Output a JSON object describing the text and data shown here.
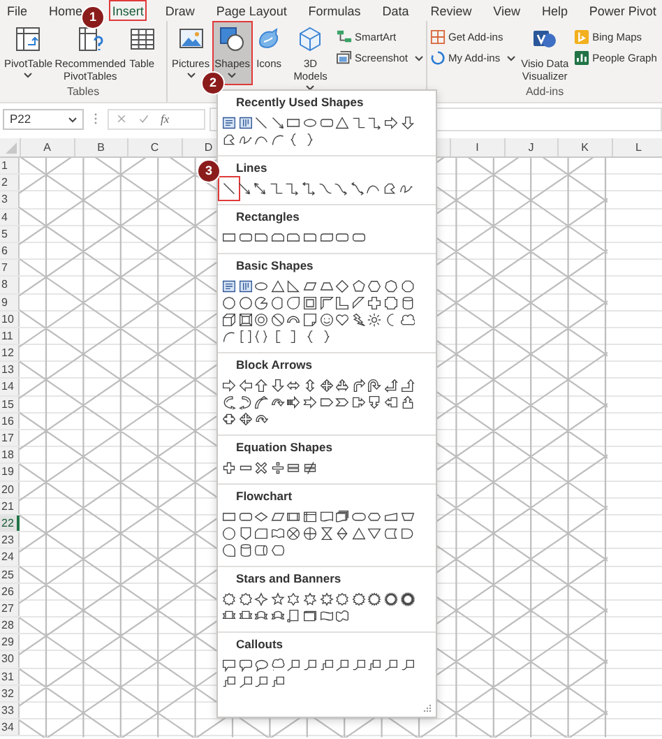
{
  "tabs": [
    {
      "label": "File",
      "selected": false,
      "marked": false
    },
    {
      "label": "Home",
      "selected": false,
      "marked": false
    },
    {
      "label": "Insert",
      "selected": true,
      "marked": true
    },
    {
      "label": "Draw",
      "selected": false,
      "marked": false
    },
    {
      "label": "Page Layout",
      "selected": false,
      "marked": false
    },
    {
      "label": "Formulas",
      "selected": false,
      "marked": false
    },
    {
      "label": "Data",
      "selected": false,
      "marked": false
    },
    {
      "label": "Review",
      "selected": false,
      "marked": false
    },
    {
      "label": "View",
      "selected": false,
      "marked": false
    },
    {
      "label": "Help",
      "selected": false,
      "marked": false
    },
    {
      "label": "Power Pivot",
      "selected": false,
      "marked": false
    }
  ],
  "ribbon": {
    "pivot_table": "PivotTable",
    "recommended_pivot_tables": "Recommended PivotTables",
    "table": "Table",
    "tables_label": "Tables",
    "pictures": "Pictures",
    "shapes": {
      "label": "Shapes",
      "pressed": true,
      "marked": true
    },
    "icons": "Icons",
    "models": "3D Models",
    "smartart": "SmartArt",
    "screenshot": "Screenshot",
    "get_addins": "Get Add-ins",
    "my_addins": "My Add-ins",
    "visio": "Visio Data Visualizer",
    "bing_maps": "Bing Maps",
    "people_graph": "People Graph",
    "addins_label": "Add-ins"
  },
  "formula_bar": {
    "name_box": "P22",
    "function": "fx"
  },
  "columns_left": [
    "A",
    "B",
    "C",
    "D"
  ],
  "columns_right": [
    "I",
    "J",
    "K",
    "L"
  ],
  "rows": [
    {
      "label": "1",
      "selected": false
    },
    {
      "label": "2",
      "selected": false
    },
    {
      "label": "3",
      "selected": false
    },
    {
      "label": "4",
      "selected": false
    },
    {
      "label": "5",
      "selected": false
    },
    {
      "label": "6",
      "selected": false
    },
    {
      "label": "7",
      "selected": false
    },
    {
      "label": "8",
      "selected": false
    },
    {
      "label": "9",
      "selected": false
    },
    {
      "label": "10",
      "selected": false
    },
    {
      "label": "11",
      "selected": false
    },
    {
      "label": "12",
      "selected": false
    },
    {
      "label": "13",
      "selected": false
    },
    {
      "label": "14",
      "selected": false
    },
    {
      "label": "15",
      "selected": false
    },
    {
      "label": "16",
      "selected": false
    },
    {
      "label": "17",
      "selected": false
    },
    {
      "label": "18",
      "selected": false
    },
    {
      "label": "19",
      "selected": false
    },
    {
      "label": "20",
      "selected": false
    },
    {
      "label": "21",
      "selected": false
    },
    {
      "label": "22",
      "selected": true
    },
    {
      "label": "23",
      "selected": false
    },
    {
      "label": "24",
      "selected": false
    },
    {
      "label": "25",
      "selected": false
    },
    {
      "label": "26",
      "selected": false
    },
    {
      "label": "27",
      "selected": false
    },
    {
      "label": "28",
      "selected": false
    },
    {
      "label": "29",
      "selected": false
    },
    {
      "label": "30",
      "selected": false
    },
    {
      "label": "31",
      "selected": false
    },
    {
      "label": "32",
      "selected": false
    },
    {
      "label": "33",
      "selected": false
    },
    {
      "label": "34",
      "selected": false
    }
  ],
  "shapes_menu": {
    "sections": [
      {
        "title": "Recently Used Shapes",
        "rows": [
          [
            {
              "kind": "text-box"
            },
            {
              "kind": "vertical-text-box"
            },
            {
              "kind": "line"
            },
            {
              "kind": "line-arrow"
            },
            {
              "kind": "rectangle"
            },
            {
              "kind": "oval"
            },
            {
              "kind": "rounded-rectangle"
            },
            {
              "kind": "triangle"
            },
            {
              "kind": "elbow-connector"
            },
            {
              "kind": "elbow-arrow"
            },
            {
              "kind": "right-arrow"
            },
            {
              "kind": "down-arrow"
            }
          ],
          [
            {
              "kind": "freeform"
            },
            {
              "kind": "scribble"
            },
            {
              "kind": "curve"
            },
            {
              "kind": "arc"
            },
            {
              "kind": "left-brace"
            },
            {
              "kind": "right-brace"
            }
          ]
        ]
      },
      {
        "title": "Lines",
        "rows": [
          [
            {
              "kind": "line",
              "highlighted": true
            },
            {
              "kind": "line-arrow",
              "highlighted": false
            },
            {
              "kind": "double-arrow-line",
              "highlighted": false
            },
            {
              "kind": "elbow-connector",
              "highlighted": false
            },
            {
              "kind": "elbow-arrow",
              "highlighted": false
            },
            {
              "kind": "elbow-double-arrow",
              "highlighted": false
            },
            {
              "kind": "curved-connector",
              "highlighted": false
            },
            {
              "kind": "curved-arrow",
              "highlighted": false
            },
            {
              "kind": "curved-double-arrow",
              "highlighted": false
            },
            {
              "kind": "curve",
              "highlighted": false
            },
            {
              "kind": "freeform",
              "highlighted": false
            },
            {
              "kind": "scribble",
              "highlighted": false
            }
          ]
        ]
      },
      {
        "title": "Rectangles",
        "rows": [
          [
            {
              "kind": "rectangle"
            },
            {
              "kind": "rounded-rectangle"
            },
            {
              "kind": "snipped-rectangle"
            },
            {
              "kind": "snipped-corners"
            },
            {
              "kind": "snip-round-rectangle"
            },
            {
              "kind": "round-corner-rectangle"
            },
            {
              "kind": "round-corners"
            },
            {
              "kind": "rounded-rectangle"
            },
            {
              "kind": "rounded-rectangle"
            }
          ]
        ]
      },
      {
        "title": "Basic Shapes",
        "rows": [
          [
            {
              "kind": "text-box"
            },
            {
              "kind": "vertical-text-box"
            },
            {
              "kind": "oval"
            },
            {
              "kind": "triangle"
            },
            {
              "kind": "right-triangle"
            },
            {
              "kind": "parallelogram"
            },
            {
              "kind": "trapezoid"
            },
            {
              "kind": "diamond"
            },
            {
              "kind": "pentagon"
            },
            {
              "kind": "hexagon"
            },
            {
              "kind": "heptagon"
            },
            {
              "kind": "octagon"
            }
          ],
          [
            {
              "kind": "decagon"
            },
            {
              "kind": "dodecagon"
            },
            {
              "kind": "pie"
            },
            {
              "kind": "chord"
            },
            {
              "kind": "teardrop"
            },
            {
              "kind": "frame"
            },
            {
              "kind": "half-frame"
            },
            {
              "kind": "l-shape"
            },
            {
              "kind": "diagonal-stripe"
            },
            {
              "kind": "cross"
            },
            {
              "kind": "plaque"
            },
            {
              "kind": "cylinder"
            }
          ],
          [
            {
              "kind": "cube"
            },
            {
              "kind": "bevel"
            },
            {
              "kind": "donut"
            },
            {
              "kind": "no-symbol"
            },
            {
              "kind": "block-arc"
            },
            {
              "kind": "folded-corner"
            },
            {
              "kind": "smiley"
            },
            {
              "kind": "heart"
            },
            {
              "kind": "lightning"
            },
            {
              "kind": "sun"
            },
            {
              "kind": "moon"
            },
            {
              "kind": "cloud"
            }
          ],
          [
            {
              "kind": "arc"
            },
            {
              "kind": "double-bracket"
            },
            {
              "kind": "double-brace"
            },
            {
              "kind": "left-bracket"
            },
            {
              "kind": "right-bracket"
            },
            {
              "kind": "left-brace"
            },
            {
              "kind": "right-brace"
            }
          ]
        ]
      },
      {
        "title": "Block Arrows",
        "rows": [
          [
            {
              "kind": "right-arrow"
            },
            {
              "kind": "left-arrow"
            },
            {
              "kind": "up-arrow"
            },
            {
              "kind": "down-arrow"
            },
            {
              "kind": "left-right-arrow"
            },
            {
              "kind": "up-down-arrow"
            },
            {
              "kind": "quad-arrow"
            },
            {
              "kind": "left-right-up-arrow"
            },
            {
              "kind": "bent-arrow"
            },
            {
              "kind": "u-turn-arrow"
            },
            {
              "kind": "left-up-arrow"
            },
            {
              "kind": "bent-up-arrow"
            }
          ],
          [
            {
              "kind": "curved-right-arrow"
            },
            {
              "kind": "curved-left-arrow"
            },
            {
              "kind": "curved-up-arrow"
            },
            {
              "kind": "curved-down-arrow"
            },
            {
              "kind": "striped-right-arrow"
            },
            {
              "kind": "notched-right-arrow"
            },
            {
              "kind": "pentagon-arrow"
            },
            {
              "kind": "chevron"
            },
            {
              "kind": "right-arrow-callout"
            },
            {
              "kind": "down-arrow-callout"
            },
            {
              "kind": "left-arrow-callout"
            },
            {
              "kind": "up-arrow-callout"
            }
          ],
          [
            {
              "kind": "left-right-arrow-callout"
            },
            {
              "kind": "quad-arrow"
            },
            {
              "kind": "circular-arrow"
            }
          ]
        ]
      },
      {
        "title": "Equation Shapes",
        "rows": [
          [
            {
              "kind": "plus-sign"
            },
            {
              "kind": "minus-sign"
            },
            {
              "kind": "multiply-sign"
            },
            {
              "kind": "division-sign"
            },
            {
              "kind": "equal-sign"
            },
            {
              "kind": "not-equal-sign"
            }
          ]
        ]
      },
      {
        "title": "Flowchart",
        "rows": [
          [
            {
              "kind": "rectangle"
            },
            {
              "kind": "rounded-rectangle"
            },
            {
              "kind": "decision"
            },
            {
              "kind": "parallelogram"
            },
            {
              "kind": "predefined-process"
            },
            {
              "kind": "internal-storage"
            },
            {
              "kind": "document"
            },
            {
              "kind": "multidocument"
            },
            {
              "kind": "terminator"
            },
            {
              "kind": "preparation"
            },
            {
              "kind": "manual-input"
            },
            {
              "kind": "manual-operation"
            }
          ],
          [
            {
              "kind": "circle"
            },
            {
              "kind": "off-page-connector"
            },
            {
              "kind": "card"
            },
            {
              "kind": "punched-tape"
            },
            {
              "kind": "summing-junction"
            },
            {
              "kind": "or-symbol"
            },
            {
              "kind": "collate"
            },
            {
              "kind": "sort"
            },
            {
              "kind": "triangle"
            },
            {
              "kind": "merge"
            },
            {
              "kind": "stored-data"
            },
            {
              "kind": "delay"
            }
          ],
          [
            {
              "kind": "sequential-access"
            },
            {
              "kind": "cylinder"
            },
            {
              "kind": "direct-access-storage"
            },
            {
              "kind": "display"
            }
          ]
        ]
      },
      {
        "title": "Stars and Banners",
        "rows": [
          [
            {
              "kind": "star-10"
            },
            {
              "kind": "star-9"
            },
            {
              "kind": "star-4"
            },
            {
              "kind": "star-5"
            },
            {
              "kind": "star-6"
            },
            {
              "kind": "star-7"
            },
            {
              "kind": "star-8"
            },
            {
              "kind": "star-10"
            },
            {
              "kind": "star-12"
            },
            {
              "kind": "star-16"
            },
            {
              "kind": "star-24"
            },
            {
              "kind": "star-32"
            }
          ],
          [
            {
              "kind": "ribbon"
            },
            {
              "kind": "ribbon"
            },
            {
              "kind": "curved-ribbon"
            },
            {
              "kind": "curved-ribbon"
            },
            {
              "kind": "vertical-scroll"
            },
            {
              "kind": "horizontal-scroll"
            },
            {
              "kind": "wave"
            },
            {
              "kind": "double-wave"
            }
          ]
        ]
      },
      {
        "title": "Callouts",
        "rows": [
          [
            {
              "kind": "rectangular-callout"
            },
            {
              "kind": "rounded-rectangular-callout"
            },
            {
              "kind": "oval-callout"
            },
            {
              "kind": "cloud-callout"
            },
            {
              "kind": "line-callout"
            },
            {
              "kind": "line-callout-2"
            },
            {
              "kind": "line-callout-3"
            },
            {
              "kind": "line-callout"
            },
            {
              "kind": "line-callout-2"
            },
            {
              "kind": "line-callout-3"
            },
            {
              "kind": "line-callout"
            },
            {
              "kind": "line-callout-2"
            }
          ],
          [
            {
              "kind": "line-callout-3"
            },
            {
              "kind": "line-callout"
            },
            {
              "kind": "line-callout-2"
            },
            {
              "kind": "line-callout-3"
            }
          ]
        ]
      }
    ]
  },
  "badges": [
    {
      "label": "1"
    },
    {
      "label": "2"
    },
    {
      "label": "3"
    }
  ]
}
